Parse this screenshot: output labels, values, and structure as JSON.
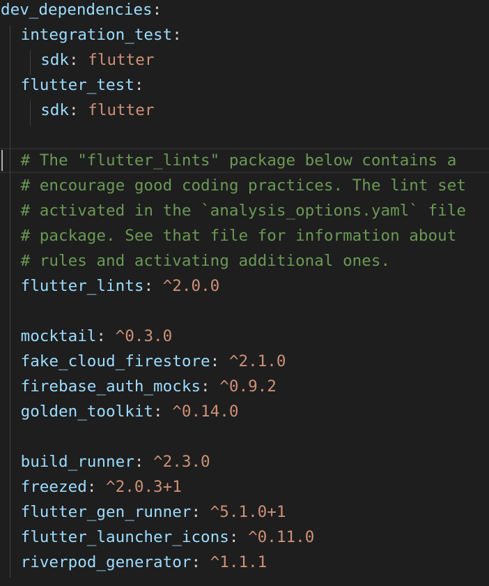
{
  "editor": {
    "lines": [
      {
        "indent": 0,
        "tokens": [
          {
            "t": "key",
            "v": "dev_dependencies"
          },
          {
            "t": "punc",
            "v": ":"
          }
        ]
      },
      {
        "indent": 1,
        "tokens": [
          {
            "t": "key",
            "v": "integration_test"
          },
          {
            "t": "punc",
            "v": ":"
          }
        ]
      },
      {
        "indent": 2,
        "tokens": [
          {
            "t": "key",
            "v": "sdk"
          },
          {
            "t": "punc",
            "v": ": "
          },
          {
            "t": "str",
            "v": "flutter"
          }
        ]
      },
      {
        "indent": 1,
        "tokens": [
          {
            "t": "key",
            "v": "flutter_test"
          },
          {
            "t": "punc",
            "v": ":"
          }
        ]
      },
      {
        "indent": 2,
        "tokens": [
          {
            "t": "key",
            "v": "sdk"
          },
          {
            "t": "punc",
            "v": ": "
          },
          {
            "t": "str",
            "v": "flutter"
          }
        ]
      },
      {
        "indent": 0,
        "tokens": []
      },
      {
        "indent": 1,
        "current": true,
        "tokens": [
          {
            "t": "comment",
            "v": "# The \"flutter_lints\" package below contains a"
          }
        ]
      },
      {
        "indent": 1,
        "tokens": [
          {
            "t": "comment",
            "v": "# encourage good coding practices. The lint set"
          }
        ]
      },
      {
        "indent": 1,
        "tokens": [
          {
            "t": "comment",
            "v": "# activated in the `analysis_options.yaml` file"
          }
        ]
      },
      {
        "indent": 1,
        "tokens": [
          {
            "t": "comment",
            "v": "# package. See that file for information about"
          }
        ]
      },
      {
        "indent": 1,
        "tokens": [
          {
            "t": "comment",
            "v": "# rules and activating additional ones."
          }
        ]
      },
      {
        "indent": 1,
        "tokens": [
          {
            "t": "key",
            "v": "flutter_lints"
          },
          {
            "t": "punc",
            "v": ": "
          },
          {
            "t": "str",
            "v": "^2.0.0"
          }
        ]
      },
      {
        "indent": 0,
        "tokens": []
      },
      {
        "indent": 1,
        "tokens": [
          {
            "t": "key",
            "v": "mocktail"
          },
          {
            "t": "punc",
            "v": ": "
          },
          {
            "t": "str",
            "v": "^0.3.0"
          }
        ]
      },
      {
        "indent": 1,
        "tokens": [
          {
            "t": "key",
            "v": "fake_cloud_firestore"
          },
          {
            "t": "punc",
            "v": ": "
          },
          {
            "t": "str",
            "v": "^2.1.0"
          }
        ]
      },
      {
        "indent": 1,
        "tokens": [
          {
            "t": "key",
            "v": "firebase_auth_mocks"
          },
          {
            "t": "punc",
            "v": ": "
          },
          {
            "t": "str",
            "v": "^0.9.2"
          }
        ]
      },
      {
        "indent": 1,
        "tokens": [
          {
            "t": "key",
            "v": "golden_toolkit"
          },
          {
            "t": "punc",
            "v": ": "
          },
          {
            "t": "str",
            "v": "^0.14.0"
          }
        ]
      },
      {
        "indent": 0,
        "tokens": []
      },
      {
        "indent": 1,
        "tokens": [
          {
            "t": "key",
            "v": "build_runner"
          },
          {
            "t": "punc",
            "v": ": "
          },
          {
            "t": "str",
            "v": "^2.3.0"
          }
        ]
      },
      {
        "indent": 1,
        "tokens": [
          {
            "t": "key",
            "v": "freezed"
          },
          {
            "t": "punc",
            "v": ": "
          },
          {
            "t": "str",
            "v": "^2.0.3+1"
          }
        ]
      },
      {
        "indent": 1,
        "tokens": [
          {
            "t": "key",
            "v": "flutter_gen_runner"
          },
          {
            "t": "punc",
            "v": ": "
          },
          {
            "t": "str",
            "v": "^5.1.0+1"
          }
        ]
      },
      {
        "indent": 1,
        "tokens": [
          {
            "t": "key",
            "v": "flutter_launcher_icons"
          },
          {
            "t": "punc",
            "v": ": "
          },
          {
            "t": "str",
            "v": "^0.11.0"
          }
        ]
      },
      {
        "indent": 1,
        "tokens": [
          {
            "t": "key",
            "v": "riverpod_generator"
          },
          {
            "t": "punc",
            "v": ": "
          },
          {
            "t": "str",
            "v": "^1.1.1"
          }
        ]
      }
    ]
  },
  "colors": {
    "background": "#1e1e1e",
    "key": "#9cdcfe",
    "punctuation": "#d4d4d4",
    "string": "#ce9178",
    "comment": "#6a9955",
    "indent_guide": "#404040"
  }
}
